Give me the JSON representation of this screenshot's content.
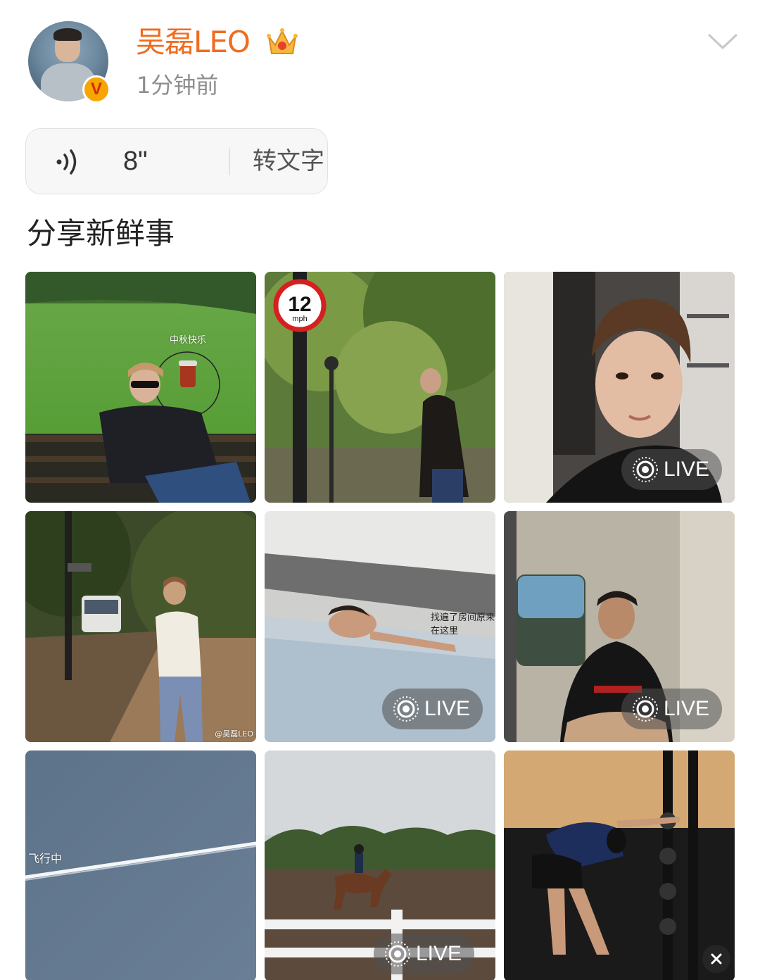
{
  "header": {
    "username": "吴磊LEO",
    "timestamp": "1分钟前",
    "verified_badge": "V",
    "icons": [
      "crown-icon",
      "chevron-down-icon"
    ]
  },
  "voice": {
    "duration": "8\"",
    "to_text_label": "转文字",
    "icon": "sound-wave-icon"
  },
  "post": {
    "text": "分享新鲜事"
  },
  "photos": {
    "live_label": "LIVE",
    "tile1_caption": "中秋快乐",
    "tile2_sign_value": "12",
    "tile2_sign_unit": "mph",
    "tile4_watermark": "@吴磊LEO",
    "tile5_caption": "找遍了房间原来在这里",
    "tile7_caption": "飞行中"
  },
  "colors": {
    "username": "#f06c1f",
    "badge": "#f7a600",
    "timestamp": "#8e8e8e"
  }
}
